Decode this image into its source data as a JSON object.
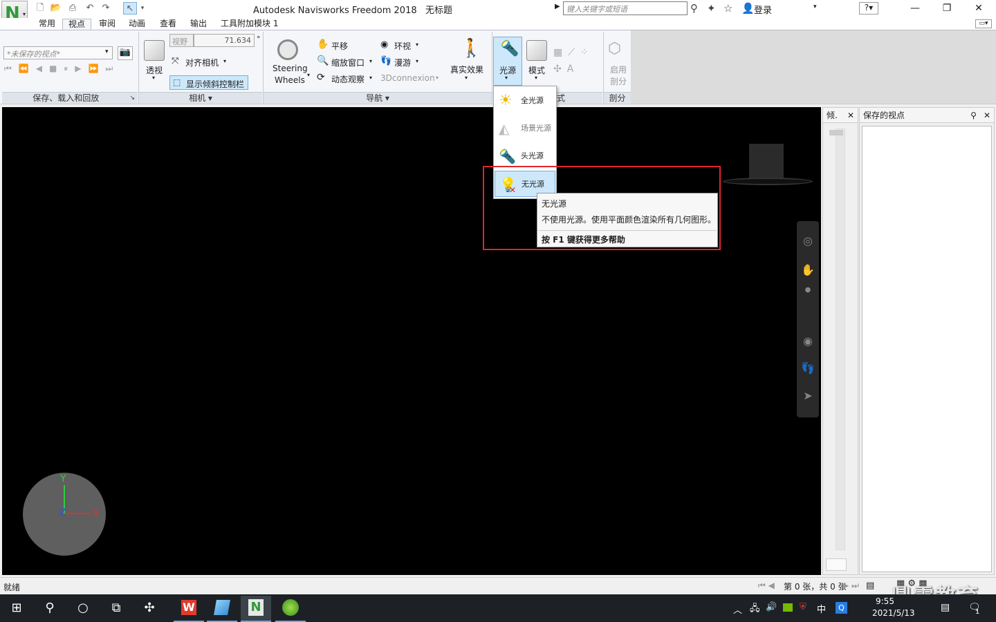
{
  "window": {
    "app_name": "Autodesk Navisworks Freedom 2018",
    "doc_title": "无标题",
    "search_placeholder": "键入关键字或短语",
    "login_label": "登录"
  },
  "tabs": [
    "常用",
    "视点",
    "审阅",
    "动画",
    "查看",
    "输出",
    "工具附加模块 1"
  ],
  "ribbon": {
    "save_combo": "*未保存的视点*",
    "panel_save": "保存、载入和回放",
    "panel_camera": "相机",
    "panel_nav": "导航",
    "panel_section": "剖分",
    "panel_mode_partial": "式",
    "perspective": "透视",
    "fov_label": "视野",
    "fov_value": "71.634",
    "fov_unit": "°",
    "align_camera": "对齐相机",
    "show_tilt": "显示倾斜控制栏",
    "steering_1": "Steering",
    "steering_2": "Wheels",
    "pan": "平移",
    "zoom_window": "缩放窗口",
    "orbit": "动态观察",
    "look_around": "环视",
    "walk": "漫游",
    "connexion": "3Dconnexion",
    "realism": "真实效果",
    "lighting": "光源",
    "mode": "模式",
    "enable_1": "启用",
    "enable_2": "剖分"
  },
  "lighting_menu": {
    "items": [
      "全光源",
      "场景光源",
      "头光源",
      "无光源"
    ]
  },
  "tooltip": {
    "title": "无光源",
    "desc": "不使用光源。使用平面颜色渲染所有几何图形。",
    "help": "按 F1 键获得更多帮助"
  },
  "panes": {
    "tilt": "倾.",
    "saved_views": "保存的视点"
  },
  "compass": {
    "y": "Y",
    "z": "Z",
    "x": "X"
  },
  "status": {
    "ready": "就绪",
    "sheet": "第 0 张，共 0 张"
  },
  "taskbar": {
    "time": "9:55",
    "date": "2021/5/13",
    "ime": "中",
    "notif": "1"
  },
  "watermark": "鼎需教育"
}
